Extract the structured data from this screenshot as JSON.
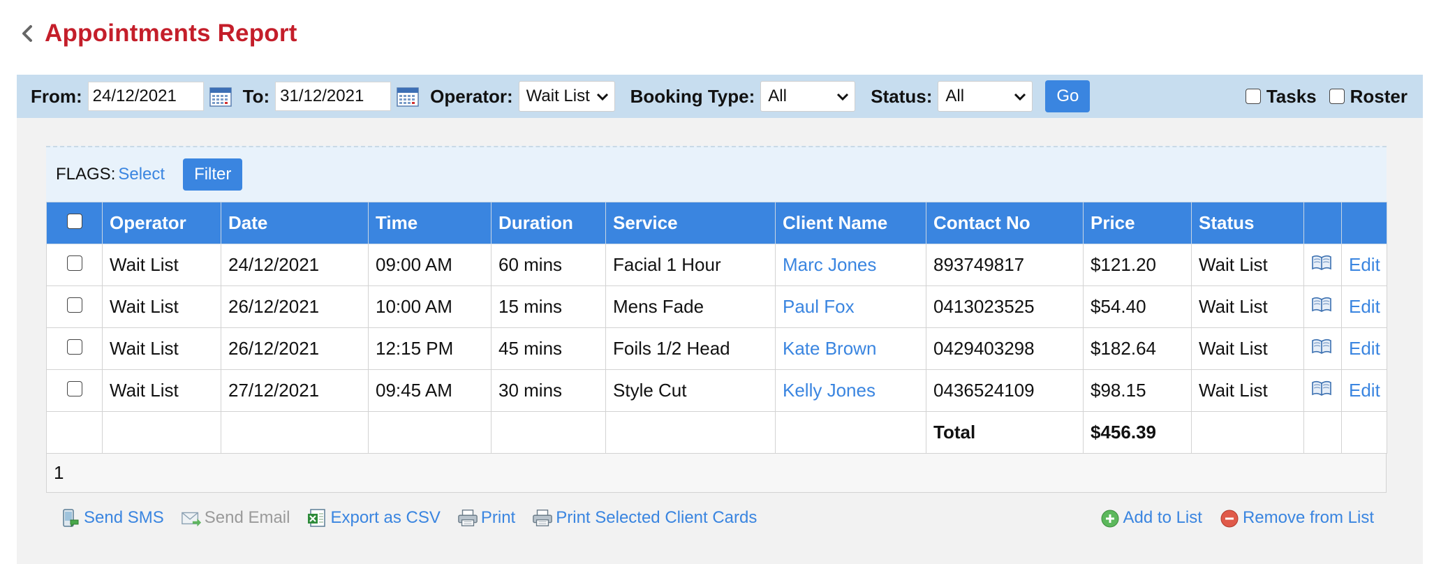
{
  "header": {
    "title": "Appointments Report"
  },
  "filters": {
    "from_label": "From:",
    "from_value": "24/12/2021",
    "to_label": "To:",
    "to_value": "31/12/2021",
    "operator_label": "Operator:",
    "operator_value": "Wait List",
    "booking_type_label": "Booking Type:",
    "booking_type_value": "All",
    "status_label": "Status:",
    "status_value": "All",
    "go_label": "Go",
    "tasks_label": "Tasks",
    "roster_label": "Roster"
  },
  "flags": {
    "label": "FLAGS:",
    "select_link": "Select",
    "filter_button": "Filter"
  },
  "table": {
    "columns": [
      "Operator",
      "Date",
      "Time",
      "Duration",
      "Service",
      "Client Name",
      "Contact No",
      "Price",
      "Status"
    ],
    "rows": [
      {
        "operator": "Wait List",
        "date": "24/12/2021",
        "time": "09:00 AM",
        "duration": "60 mins",
        "service": "Facial 1 Hour",
        "client": "Marc Jones",
        "contact": "893749817",
        "price": "$121.20",
        "status": "Wait List",
        "edit": "Edit"
      },
      {
        "operator": "Wait List",
        "date": "26/12/2021",
        "time": "10:00 AM",
        "duration": "15 mins",
        "service": "Mens Fade",
        "client": "Paul Fox",
        "contact": "0413023525",
        "price": "$54.40",
        "status": "Wait List",
        "edit": "Edit"
      },
      {
        "operator": "Wait List",
        "date": "26/12/2021",
        "time": "12:15 PM",
        "duration": "45 mins",
        "service": "Foils 1/2 Head",
        "client": "Kate Brown",
        "contact": "0429403298",
        "price": "$182.64",
        "status": "Wait List",
        "edit": "Edit"
      },
      {
        "operator": "Wait List",
        "date": "27/12/2021",
        "time": "09:45 AM",
        "duration": "30 mins",
        "service": "Style Cut",
        "client": "Kelly Jones",
        "contact": "0436524109",
        "price": "$98.15",
        "status": "Wait List",
        "edit": "Edit"
      }
    ],
    "total_label": "Total",
    "total_value": "$456.39"
  },
  "pager": {
    "page": "1"
  },
  "actions": {
    "send_sms": "Send SMS",
    "send_email": "Send Email",
    "export_csv": "Export as CSV",
    "print": "Print",
    "print_cards": "Print Selected Client Cards",
    "add_to_list": "Add to List",
    "remove_from_list": "Remove from List"
  },
  "colors": {
    "title": "#c41e2a",
    "accent": "#3a85e0",
    "filter_bar": "#c7ddef",
    "panel": "#f2f2f2"
  }
}
